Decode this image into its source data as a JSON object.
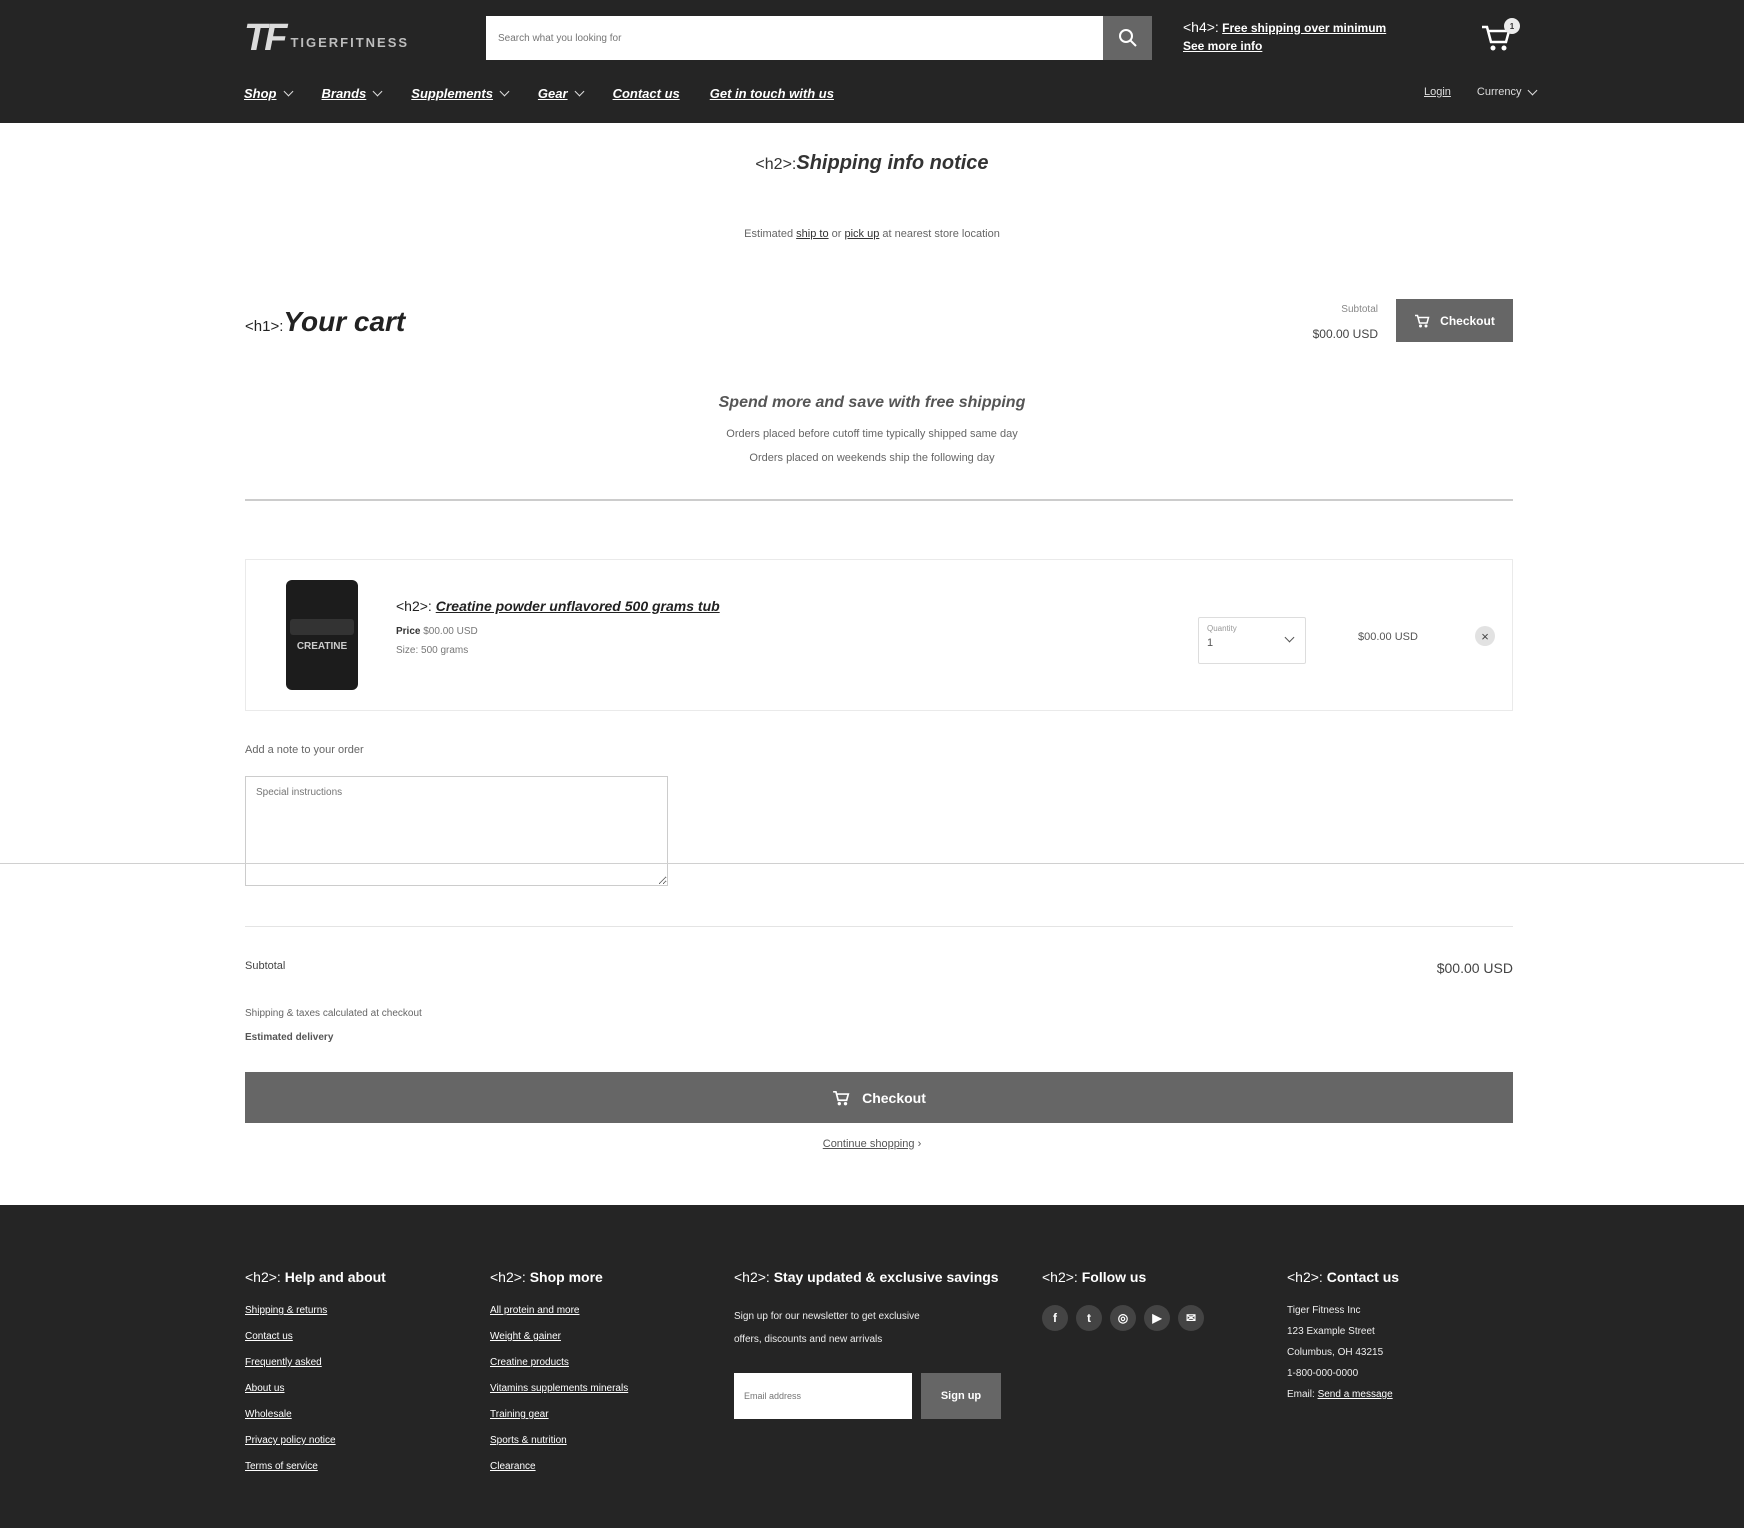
{
  "header": {
    "logo_mark": "TF",
    "logo_word": "TIGERFITNESS",
    "search_placeholder": "Search what you looking for",
    "promo_tag": "<h4>:",
    "promo_text": "Free shipping over minimum",
    "promo_link": "See more info",
    "cart_count": "1",
    "nav": [
      "Shop",
      "Brands",
      "Supplements",
      "Gear",
      "Contact us",
      "Get in touch with us"
    ],
    "nav_right": [
      "Login",
      "Currency"
    ]
  },
  "main": {
    "notice_tag": "<h2>:",
    "notice_title": "Shipping info notice",
    "notice_sub_1": "Estimated",
    "notice_sub_link1": "ship to",
    "notice_sub_2": "or",
    "notice_sub_link2": "pick up",
    "notice_sub_3": "at nearest store location",
    "title_tag": "<h1>:",
    "title": "Your cart",
    "top_total_label": "Subtotal",
    "top_total_value": "$00.00 USD",
    "checkout_label": "Checkout",
    "promo_heading": "Spend more and save with free shipping",
    "promo_line1": "Orders placed before cutoff time typically shipped same day",
    "promo_line2": "Orders placed on weekends ship the following day",
    "item": {
      "thumb_label": "CREATINE",
      "title_tag": "<h2>:",
      "title": "Creatine powder unflavored 500 grams tub",
      "meta_bold": "Price",
      "meta_text": "$00.00 USD",
      "sub": "Size: 500 grams",
      "qty_label": "Quantity",
      "qty_value": "1",
      "line_price": "$00.00 USD",
      "remove": "×"
    },
    "note_label": "Add a note to your order",
    "note_placeholder": "Special instructions",
    "subtotal_label": "Subtotal",
    "subtotal_value": "$00.00 USD",
    "tax_note": "Shipping & taxes calculated at checkout",
    "tax_note_bold": "Estimated delivery",
    "checkout_main": "Checkout",
    "continue_link": "Continue shopping"
  },
  "footer": {
    "col1": {
      "tag": "<h2>:",
      "title": "Help and about",
      "links": [
        "Shipping & returns",
        "Contact us",
        "Frequently asked",
        "About us",
        "Wholesale",
        "Privacy policy notice",
        "Terms of service"
      ]
    },
    "col2": {
      "tag": "<h2>:",
      "title": "Shop more",
      "links": [
        "All protein and more",
        "Weight & gainer",
        "Creatine products",
        "Vitamins supplements minerals",
        "Training gear",
        "Sports & nutrition",
        "Clearance"
      ]
    },
    "col3": {
      "tag": "<h2>:",
      "title": "Stay updated & exclusive savings",
      "text1": "Sign up for our newsletter to get exclusive",
      "text2": "offers, discounts and new arrivals",
      "input_placeholder": "Email address",
      "button": "Sign up"
    },
    "col4": {
      "tag": "<h2>:",
      "title": "Follow us",
      "icons": [
        "f",
        "t",
        "◎",
        "▶",
        "✉"
      ]
    },
    "col5": {
      "tag": "<h2>:",
      "title": "Contact us",
      "lines": [
        "Tiger Fitness Inc",
        "123 Example Street",
        "Columbus, OH 43215",
        "1-800-000-0000"
      ],
      "link_prefix": "Email:",
      "link": "Send a message"
    }
  }
}
